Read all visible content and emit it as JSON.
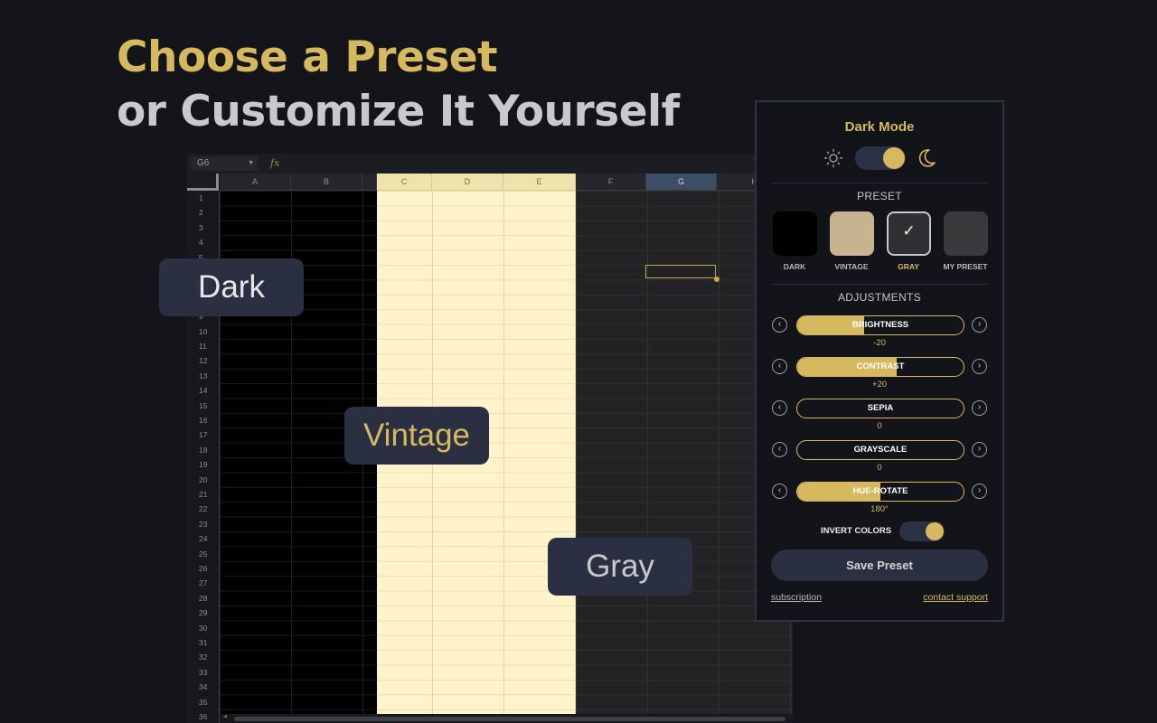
{
  "headline": {
    "line1": "Choose a Preset",
    "line2": "or Customize It Yourself"
  },
  "spreadsheet": {
    "name_box": "G6",
    "formula_icon": "fx",
    "columns": [
      "A",
      "B",
      "C",
      "D",
      "E",
      "F",
      "G",
      "H"
    ],
    "selected_column": "G",
    "rows": [
      "1",
      "2",
      "3",
      "4",
      "5",
      "6",
      "7",
      "8",
      "9",
      "10",
      "11",
      "12",
      "13",
      "14",
      "15",
      "16",
      "17",
      "18",
      "19",
      "20",
      "21",
      "22",
      "23",
      "24",
      "25",
      "26",
      "27",
      "28",
      "29",
      "30",
      "31",
      "32",
      "33",
      "34",
      "35",
      "36"
    ]
  },
  "badges": {
    "dark": "Dark",
    "vintage": "Vintage",
    "gray": "Gray"
  },
  "panel": {
    "title": "Dark Mode",
    "dark_mode_on": true,
    "preset_heading": "PRESET",
    "presets": [
      {
        "label": "DARK",
        "color": "#000000",
        "selected": false
      },
      {
        "label": "VINTAGE",
        "color": "#c8b390",
        "selected": false
      },
      {
        "label": "GRAY",
        "color": "#303032",
        "selected": true
      },
      {
        "label": "MY PRESET",
        "color": "#3a3a3c",
        "selected": false
      }
    ],
    "adjustments_heading": "ADJUSTMENTS",
    "sliders": [
      {
        "label": "BRIGHTNESS",
        "value": "-20",
        "level": 0.4
      },
      {
        "label": "CONTRAST",
        "value": "+20",
        "level": 0.6
      },
      {
        "label": "SEPIA",
        "value": "0",
        "level": 0
      },
      {
        "label": "GRAYSCALE",
        "value": "0",
        "level": 0
      },
      {
        "label": "HUE-ROTATE",
        "value": "180°",
        "level": 0.5
      }
    ],
    "invert_label": "INVERT COLORS",
    "invert_on": true,
    "save_label": "Save Preset",
    "footer_left": "subscription",
    "footer_right": "contact support"
  },
  "colors": {
    "accent": "#d6b85e",
    "panel_bg": "#13141a",
    "button_bg": "#2a2f42"
  }
}
